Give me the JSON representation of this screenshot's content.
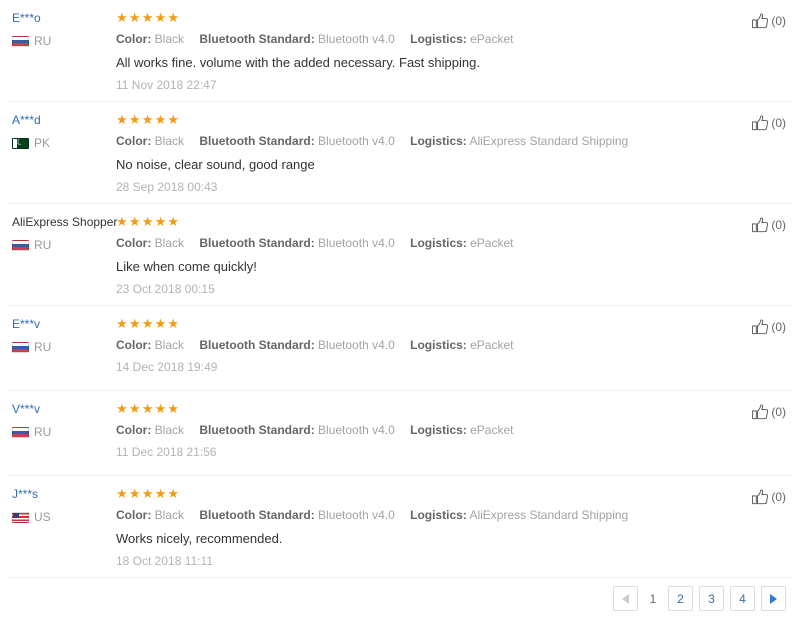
{
  "labels": {
    "color": "Color:",
    "bluetooth": "Bluetooth Standard:",
    "logistics": "Logistics:",
    "stars_full": "★★★★★"
  },
  "reviews": [
    {
      "user": "E***o",
      "user_style": "link",
      "country_code": "RU",
      "flag": "flag-ru",
      "rating_stars": "★★★★★",
      "rating_value": 5,
      "color_value": "Black",
      "bluetooth_value": "Bluetooth v4.0",
      "logistics_value": "ePacket",
      "comment": "All works fine. volume with the added necessary. Fast shipping.",
      "date": "11 Nov 2018 22:47",
      "helpful": "(0)"
    },
    {
      "user": "A***d",
      "user_style": "link",
      "country_code": "PK",
      "flag": "flag-pk",
      "rating_stars": "★★★★★",
      "rating_value": 5,
      "color_value": "Black",
      "bluetooth_value": "Bluetooth v4.0",
      "logistics_value": "AliExpress Standard Shipping",
      "comment": "No noise, clear sound, good range",
      "date": "28 Sep 2018 00:43",
      "helpful": "(0)"
    },
    {
      "user": "AliExpress Shopper",
      "user_style": "plain",
      "country_code": "RU",
      "flag": "flag-ru",
      "rating_stars": "★★★★★",
      "rating_value": 5,
      "color_value": "Black",
      "bluetooth_value": "Bluetooth v4.0",
      "logistics_value": "ePacket",
      "comment": "Like when come quickly!",
      "date": "23 Oct 2018 00:15",
      "helpful": "(0)"
    },
    {
      "user": "E***v",
      "user_style": "link",
      "country_code": "RU",
      "flag": "flag-ru",
      "rating_stars": "★★★★★",
      "rating_value": 5,
      "color_value": "Black",
      "bluetooth_value": "Bluetooth v4.0",
      "logistics_value": "ePacket",
      "comment": "",
      "date": "14 Dec 2018 19:49",
      "helpful": "(0)"
    },
    {
      "user": "V***v",
      "user_style": "link",
      "country_code": "RU",
      "flag": "flag-ru",
      "rating_stars": "★★★★★",
      "rating_value": 5,
      "color_value": "Black",
      "bluetooth_value": "Bluetooth v4.0",
      "logistics_value": "ePacket",
      "comment": "",
      "date": "11 Dec 2018 21:56",
      "helpful": "(0)"
    },
    {
      "user": "J***s",
      "user_style": "link",
      "country_code": "US",
      "flag": "flag-us",
      "rating_stars": "★★★★★",
      "rating_value": 5,
      "color_value": "Black",
      "bluetooth_value": "Bluetooth v4.0",
      "logistics_value": "AliExpress Standard Shipping",
      "comment": "Works nicely, recommended.",
      "date": "18 Oct 2018 11:11",
      "helpful": "(0)"
    }
  ],
  "pagination": {
    "prev_icon": "triangle-left-icon",
    "next_icon": "triangle-right-icon",
    "current_page": "1",
    "pages": [
      "2",
      "3",
      "4"
    ],
    "prev_enabled": false,
    "next_enabled": true
  },
  "colors": {
    "star": "#f39c12",
    "link": "#2f6bb5",
    "pagination_active": "#2f7bd6",
    "pagination_disabled": "#cfcfcf",
    "divider": "#eeeeee"
  }
}
